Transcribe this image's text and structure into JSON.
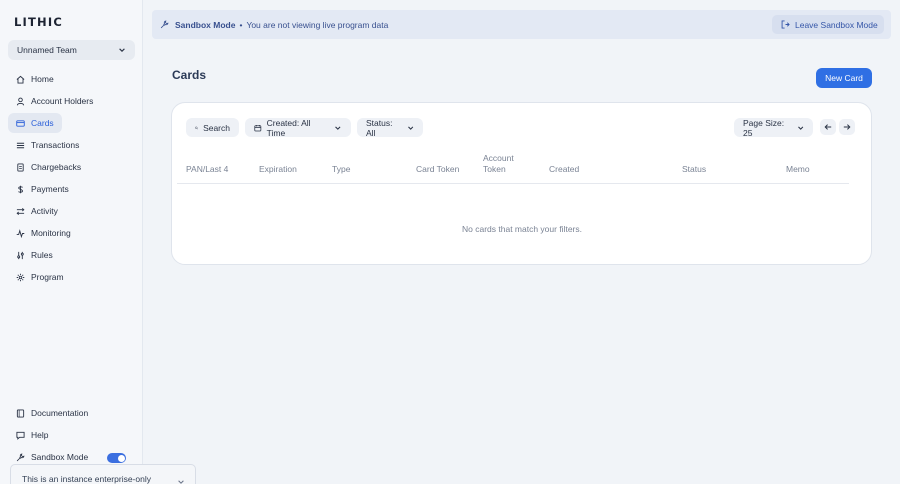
{
  "app": {
    "logo": "LITHIC"
  },
  "sidebar": {
    "team": "Unnamed Team",
    "items": [
      {
        "label": "Home"
      },
      {
        "label": "Account Holders"
      },
      {
        "label": "Cards"
      },
      {
        "label": "Transactions"
      },
      {
        "label": "Chargebacks"
      },
      {
        "label": "Payments"
      },
      {
        "label": "Activity"
      },
      {
        "label": "Monitoring"
      },
      {
        "label": "Rules"
      },
      {
        "label": "Program"
      }
    ],
    "bottom": [
      {
        "label": "Documentation"
      },
      {
        "label": "Help"
      },
      {
        "label": "Sandbox Mode"
      }
    ],
    "sandbox_toggle_on": true,
    "popup_text": "This is an instance enterprise-only"
  },
  "banner": {
    "mode": "Sandbox Mode",
    "separator": "•",
    "message": "You are not viewing live program data",
    "leave_label": "Leave Sandbox Mode"
  },
  "main": {
    "title": "Cards",
    "new_card_label": "New Card",
    "filters": {
      "search_label": "Search",
      "created_label": "Created: All Time",
      "status_label": "Status: All",
      "page_size_label": "Page Size: 25"
    },
    "columns": [
      "PAN/Last 4",
      "Expiration",
      "Type",
      "Card Token",
      "Account",
      "Token",
      "Created",
      "Status",
      "Memo"
    ],
    "empty_message": "No cards that match your filters."
  },
  "colors": {
    "accent": "#2f6fe4",
    "banner": "#e3e9f4",
    "active_nav": "#2b5fd9"
  }
}
